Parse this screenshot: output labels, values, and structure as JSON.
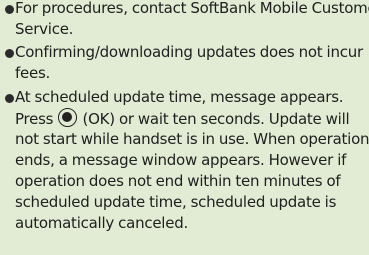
{
  "notes": [
    {
      "lines": [
        "For procedures, contact SoftBank Mobile Customer",
        "Service."
      ]
    },
    {
      "lines": [
        "Confirming/downloading updates does not incur",
        "fees."
      ]
    },
    {
      "line1": "At scheduled update time, message appears.",
      "line2_before_icon": "Press ",
      "button_icon": "center-key-icon",
      "line2_after_icon": " (OK) or wait ten seconds. Update will",
      "lines_rest": [
        "not start while handset is in use. When operation",
        "ends, a message window appears. However if",
        "operation does not end within ten minutes of",
        "scheduled update time, scheduled update is",
        "automatically canceled."
      ]
    }
  ]
}
